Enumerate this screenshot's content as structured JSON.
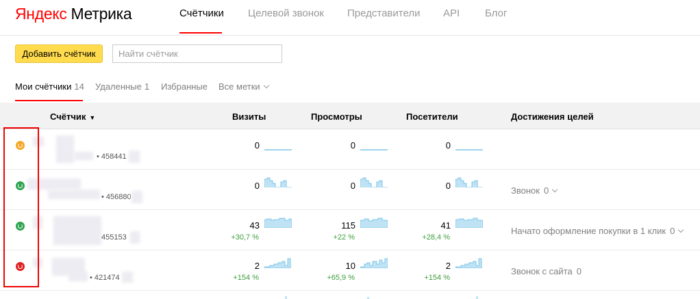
{
  "header": {
    "logo_brand": "Яндекс",
    "logo_product": "Метрика",
    "nav": [
      {
        "label": "Счётчики",
        "active": true
      },
      {
        "label": "Целевой звонок",
        "active": false
      },
      {
        "label": "Представители",
        "active": false
      },
      {
        "label": "API",
        "active": false
      },
      {
        "label": "Блог",
        "active": false
      }
    ]
  },
  "toolbar": {
    "add_label": "Добавить счётчик",
    "search_placeholder": "Найти счётчик"
  },
  "filters": [
    {
      "label": "Мои счётчики",
      "count": "14"
    },
    {
      "label": "Удаленные",
      "count": "1"
    },
    {
      "label": "Избранные",
      "count": ""
    },
    {
      "label": "Все метки",
      "count": ""
    }
  ],
  "table": {
    "headers": {
      "counter": "Счётчик",
      "visits": "Визиты",
      "views": "Просмотры",
      "visitors": "Посетители",
      "goals": "Достижения целей"
    },
    "rows": [
      {
        "status_color": "#f5a623",
        "id": "• 458441",
        "visits": "0",
        "visits_delta": "",
        "views": "0",
        "views_delta": "",
        "visitors": "0",
        "visitors_delta": "",
        "goal": "",
        "goal_count": ""
      },
      {
        "status_color": "#2ea44f",
        "id": "• 456880",
        "visits": "0",
        "visits_delta": "",
        "views": "0",
        "views_delta": "",
        "visitors": "0",
        "visitors_delta": "",
        "goal": "Звонок",
        "goal_count": "0"
      },
      {
        "status_color": "#2ea44f",
        "id": "455153",
        "visits": "43",
        "visits_delta": "+30,7 %",
        "views": "115",
        "views_delta": "+22 %",
        "visitors": "41",
        "visitors_delta": "+28,4 %",
        "goal": "Начато оформление покупки в 1 клик",
        "goal_count": "0"
      },
      {
        "status_color": "#e02020",
        "id": "• 421474",
        "visits": "2",
        "visits_delta": "+154 %",
        "views": "10",
        "views_delta": "+65,9 %",
        "visitors": "2",
        "visitors_delta": "+154 %",
        "goal": "Звонок с сайта",
        "goal_count": "0"
      }
    ]
  },
  "colors": {
    "accent": "#ff0000",
    "button": "#ffdb4d",
    "positive": "#3b9e3b",
    "sparkline": "#a8d8ef"
  }
}
